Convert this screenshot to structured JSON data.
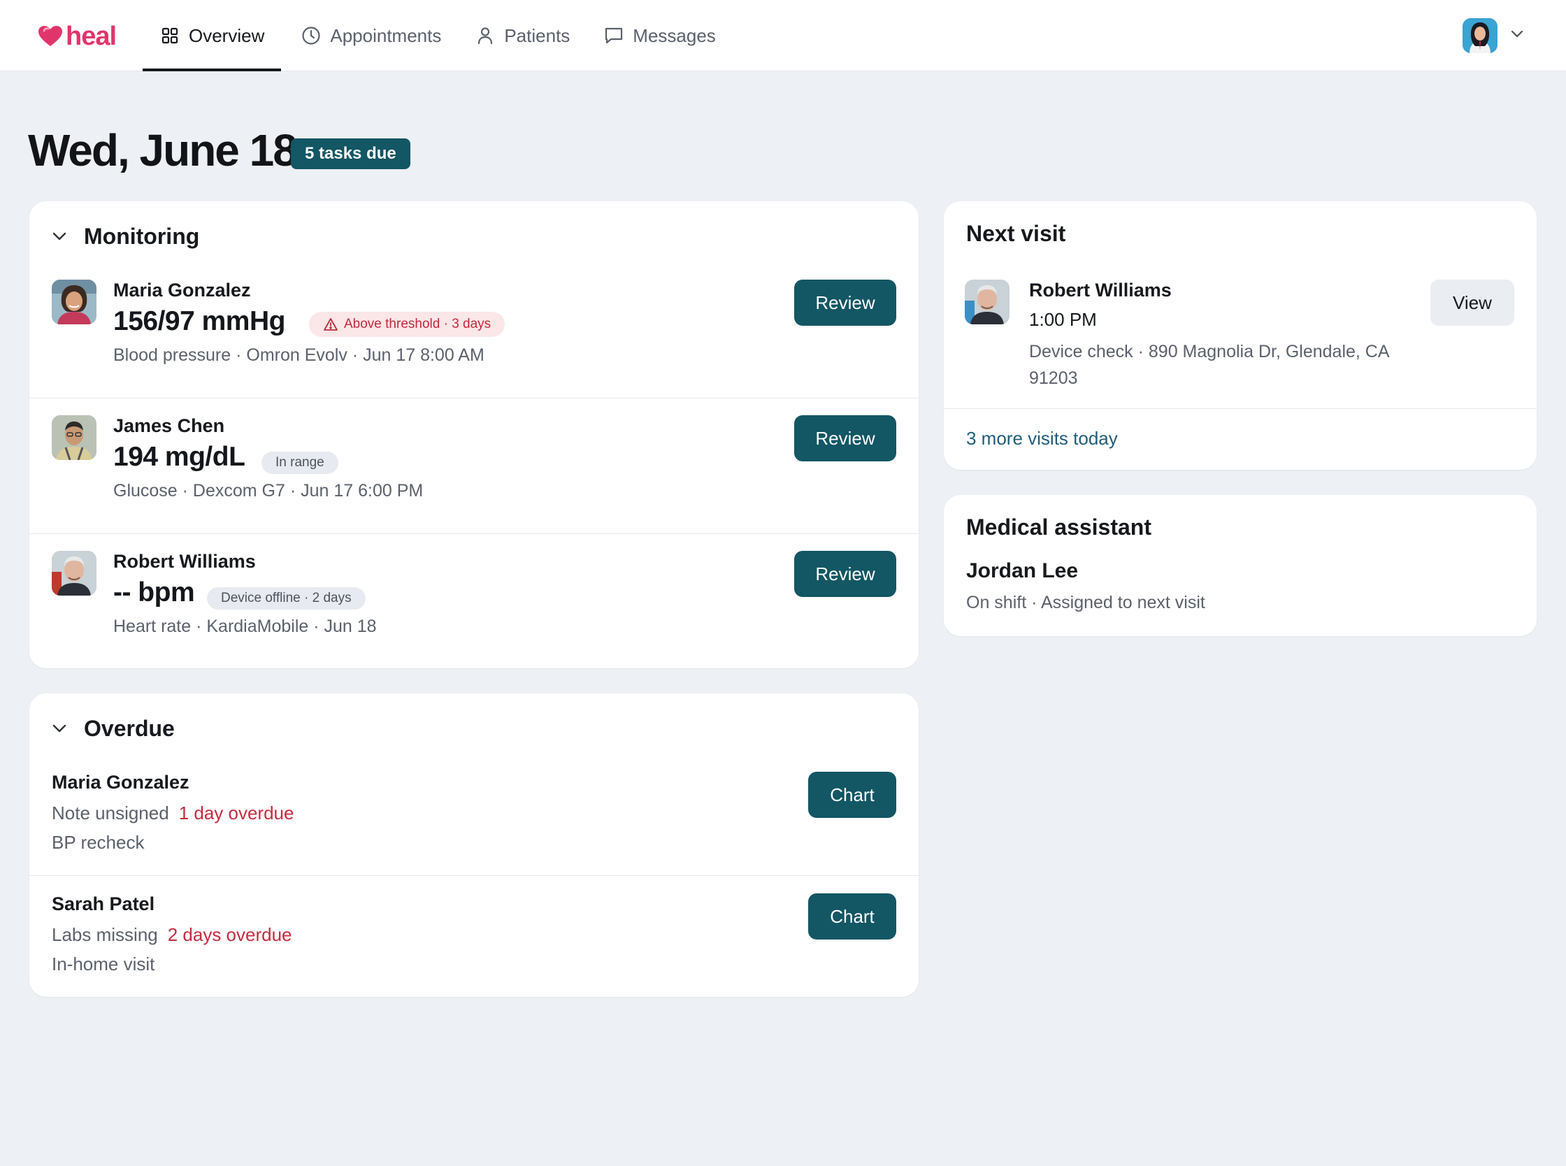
{
  "app": {
    "brand": "heal",
    "brand_color": "#e0356b",
    "accent_color": "#135664"
  },
  "nav": {
    "tabs": [
      {
        "label": "Overview",
        "icon": "grid-icon",
        "active": true
      },
      {
        "label": "Appointments",
        "icon": "clock-icon",
        "active": false
      },
      {
        "label": "Patients",
        "icon": "person-icon",
        "active": false
      },
      {
        "label": "Messages",
        "icon": "message-icon",
        "active": false
      }
    ]
  },
  "header": {
    "date_title": "Wed, June 18",
    "tasks_badge": "5 tasks due"
  },
  "monitoring": {
    "title": "Monitoring",
    "items": [
      {
        "name": "Maria Gonzalez",
        "value": "156/97 mmHg",
        "badge": "Above threshold · 3 days",
        "badge_kind": "warning",
        "meta": "Blood pressure · Omron Evolv · Jun 17 8:00 AM",
        "action": "Review"
      },
      {
        "name": "James Chen",
        "value": "194 mg/dL",
        "badge": "In range",
        "badge_kind": "neutral",
        "meta": "Glucose · Dexcom G7 · Jun 17 6:00 PM",
        "action": "Review"
      },
      {
        "name": "Robert Williams",
        "value": "-- bpm",
        "badge": "Device offline · 2 days",
        "badge_kind": "neutral",
        "meta": "Heart rate · KardiaMobile · Jun 18",
        "action": "Review"
      }
    ]
  },
  "overdue": {
    "title": "Overdue",
    "items": [
      {
        "name": "Maria Gonzalez",
        "task": "Note unsigned",
        "overdue": "1 day overdue",
        "detail": "BP recheck",
        "action": "Chart"
      },
      {
        "name": "Sarah Patel",
        "task": "Labs missing",
        "overdue": "2 days overdue",
        "detail": "In-home visit",
        "action": "Chart"
      }
    ]
  },
  "next_visit": {
    "title": "Next visit",
    "name": "Robert Williams",
    "time": "1:00 PM",
    "address": "Device check · 890 Magnolia Dr, Glendale, CA 91203",
    "action": "View",
    "more_link": "3 more visits today"
  },
  "medical_assistant": {
    "title": "Medical assistant",
    "name": "Jordan Lee",
    "status": "On shift · Assigned to next visit"
  }
}
